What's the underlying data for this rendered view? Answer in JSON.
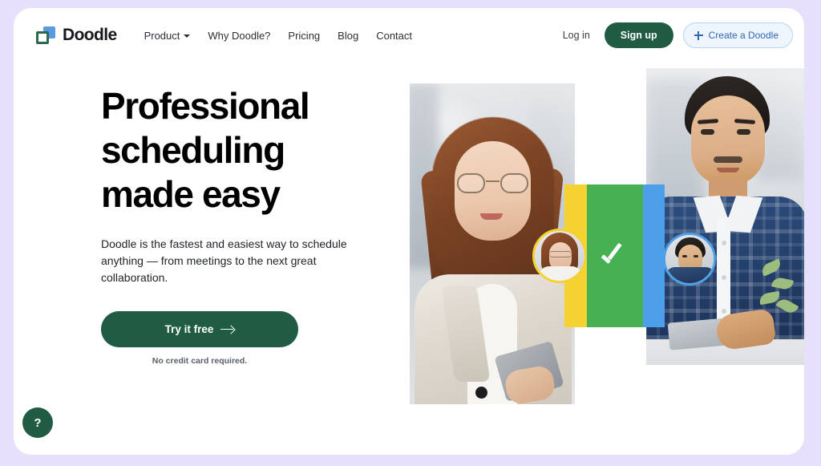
{
  "header": {
    "brand": {
      "name": "Doodle",
      "logo_icon": "doodle-logo-icon"
    },
    "nav": [
      {
        "label": "Product",
        "has_dropdown": true,
        "icon": "chevron-down-icon"
      },
      {
        "label": "Why Doodle?",
        "has_dropdown": false
      },
      {
        "label": "Pricing",
        "has_dropdown": false
      },
      {
        "label": "Blog",
        "has_dropdown": false
      },
      {
        "label": "Contact",
        "has_dropdown": false
      }
    ],
    "login_label": "Log in",
    "signup_label": "Sign up",
    "create_label": "Create a Doodle",
    "create_icon": "plus-icon"
  },
  "hero": {
    "title": "Professional\nscheduling\nmade easy",
    "subtitle": "Doodle is the fastest and easiest way to schedule anything — from meetings to the next great collaboration.",
    "cta_label": "Try it free",
    "cta_icon": "arrow-right-icon",
    "cta_note": "No credit card required."
  },
  "collage": {
    "check_icon": "check-icon",
    "photo_left_alt": "Woman with glasses holding tablet",
    "photo_right_alt": "Man in plaid shirt at laptop",
    "avatar_left_alt": "Woman avatar",
    "avatar_right_alt": "Man avatar"
  },
  "help": {
    "label": "?",
    "icon": "question-mark-icon"
  },
  "colors": {
    "page_background": "#e6e0fb",
    "card_background": "#ffffff",
    "brand_green": "#1f5c43",
    "accent_blue": "#3367b5",
    "bar_yellow": "#f5d231",
    "bar_green": "#46b053",
    "bar_blue": "#4c9fe8",
    "logo_green": "#2d6a4d",
    "logo_blue": "#5b9ae0"
  }
}
